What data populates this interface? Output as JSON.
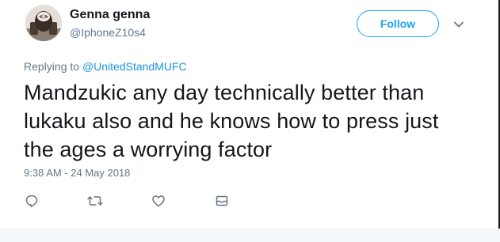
{
  "user": {
    "display_name": "Genna genna",
    "handle": "@IphoneZ10s4"
  },
  "header": {
    "follow_label": "Follow",
    "menu_icon": "chevron-down-icon"
  },
  "reply_context": {
    "prefix": "Replying to ",
    "mention": "@UnitedStandMUFC"
  },
  "tweet": {
    "text_lines": [
      "Mandzukic any day technically better than",
      "lukaku also and he knows how to press just",
      "the ages a worrying factor"
    ],
    "timestamp": "9:38 AM - 24 May 2018"
  },
  "actions": [
    {
      "name": "reply",
      "icon": "reply-icon"
    },
    {
      "name": "retweet",
      "icon": "retweet-icon"
    },
    {
      "name": "like",
      "icon": "heart-icon"
    },
    {
      "name": "direct-message",
      "icon": "envelope-icon"
    }
  ],
  "colors": {
    "accent": "#1da1f2",
    "link": "#1b95e0",
    "text": "#14171a",
    "muted": "#657786"
  }
}
